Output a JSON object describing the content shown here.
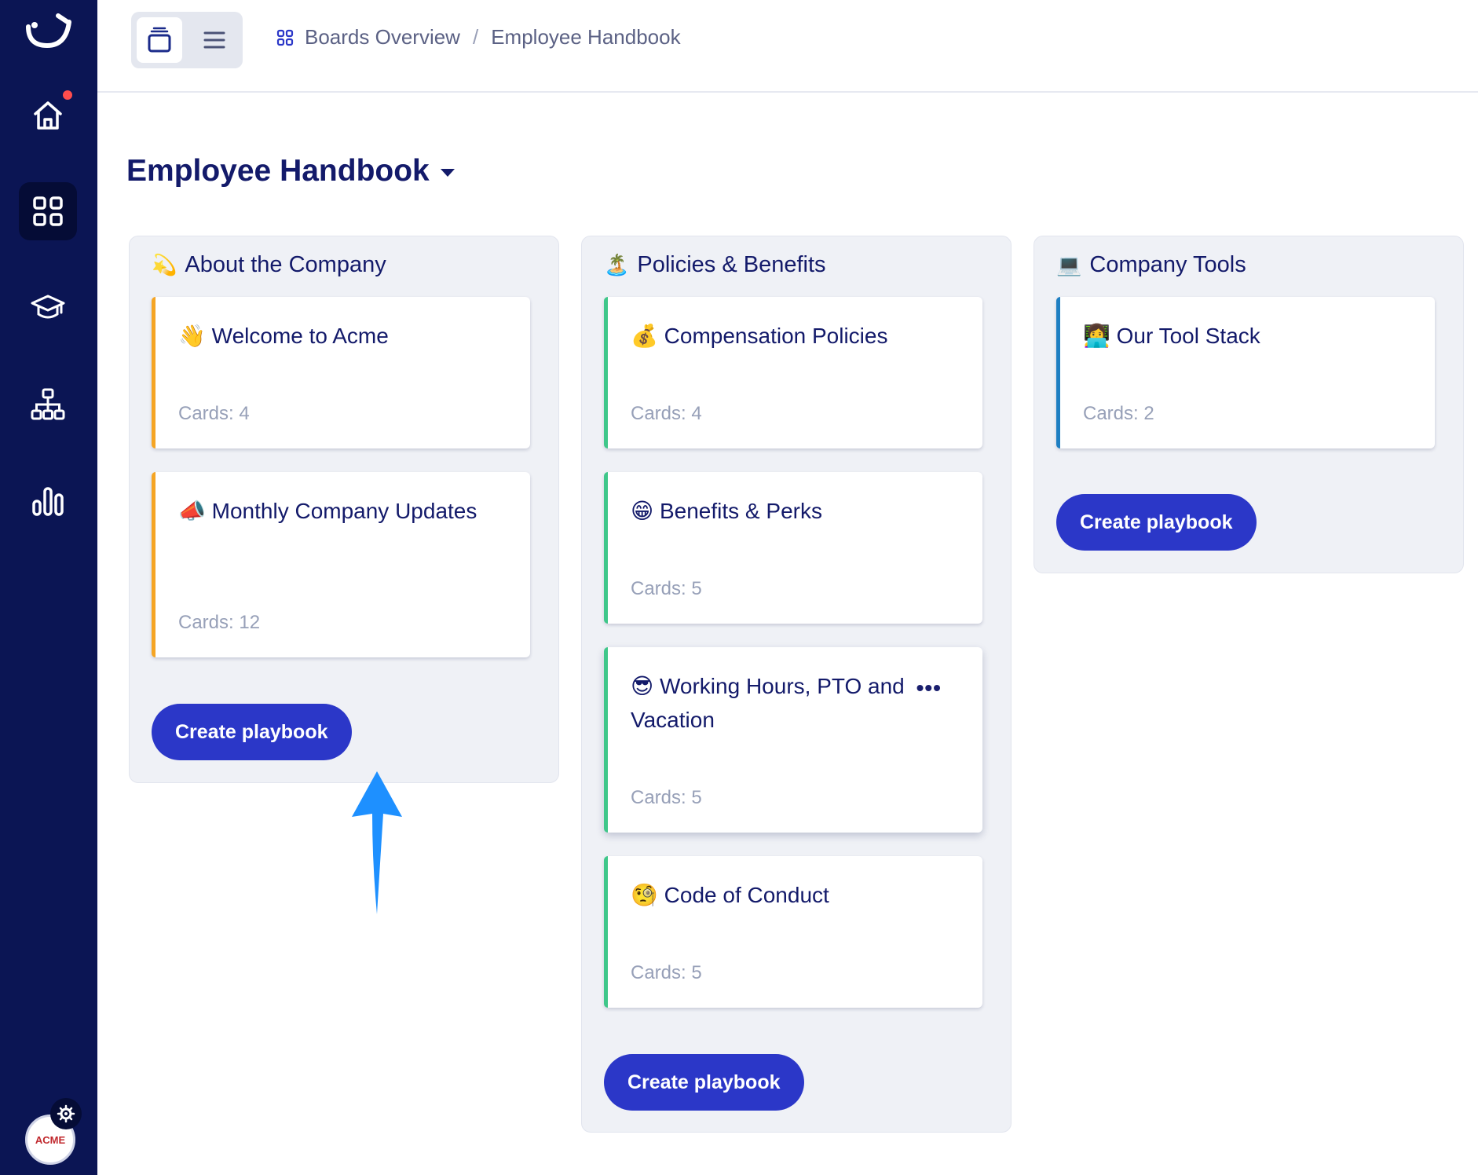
{
  "colors": {
    "sidebar": "#0b1554",
    "accent_button": "#2b37c8",
    "stripe_company": "#f5a524",
    "stripe_policies": "#3fc78a",
    "stripe_tools": "#1e7fc2",
    "arrow": "#1e90ff"
  },
  "sidebar": {
    "items": [
      {
        "icon": "home-icon",
        "active": false,
        "has_notification": true
      },
      {
        "icon": "boards-grid-icon",
        "active": true
      },
      {
        "icon": "graduation-cap-icon",
        "active": false
      },
      {
        "icon": "org-chart-icon",
        "active": false
      },
      {
        "icon": "bar-chart-icon",
        "active": false
      }
    ],
    "avatar_text": "ACME"
  },
  "breadcrumb": {
    "root": "Boards Overview",
    "separator": "/",
    "current": "Employee Handbook"
  },
  "page": {
    "title": "Employee Handbook"
  },
  "columns": [
    {
      "emoji": "💫",
      "title": "About the Company",
      "stripe": "#f5a524",
      "cards": [
        {
          "emoji": "👋",
          "title": "Welcome to Acme",
          "count": "Cards: 4"
        },
        {
          "emoji": "📣",
          "title": "Monthly Company Updates",
          "count": "Cards: 12"
        }
      ],
      "button": "Create playbook"
    },
    {
      "emoji": "🏝️",
      "title": "Policies & Benefits",
      "stripe": "#3fc78a",
      "cards": [
        {
          "emoji": "💰",
          "title": "Compensation Policies",
          "count": "Cards: 4"
        },
        {
          "emoji": "😁",
          "title": "Benefits & Perks",
          "count": "Cards: 5"
        },
        {
          "emoji": "😎",
          "title": "Working Hours, PTO and Vacation",
          "count": "Cards: 5",
          "more": "•••"
        },
        {
          "emoji": "🧐",
          "title": "Code of Conduct",
          "count": "Cards: 5"
        }
      ],
      "button": "Create playbook"
    },
    {
      "emoji": "💻",
      "title": "Company Tools",
      "stripe": "#1e7fc2",
      "cards": [
        {
          "emoji": "👩‍💻",
          "title": "Our Tool Stack",
          "count": "Cards: 2"
        }
      ],
      "button": "Create playbook"
    }
  ]
}
